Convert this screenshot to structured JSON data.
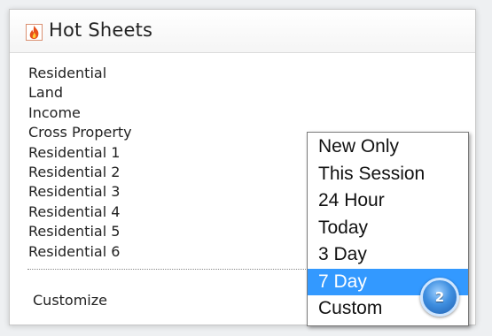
{
  "header": {
    "icon": "fire-icon",
    "title": "Hot Sheets"
  },
  "menu": {
    "items": [
      "Residential",
      "Land",
      "Income",
      "Cross Property",
      "Residential 1",
      "Residential 2",
      "Residential 3",
      "Residential 4",
      "Residential 5",
      "Residential 6"
    ],
    "customize_label": "Customize"
  },
  "dropdown": {
    "options": [
      "New Only",
      "This Session",
      "24 Hour",
      "Today",
      "3 Day",
      "7 Day",
      "Custom"
    ],
    "selected": "7 Day"
  },
  "callout": {
    "number": "2"
  },
  "colors": {
    "selected_bg": "#3399ff",
    "badge": "#3f8fe0",
    "fire": "#e8501a"
  }
}
